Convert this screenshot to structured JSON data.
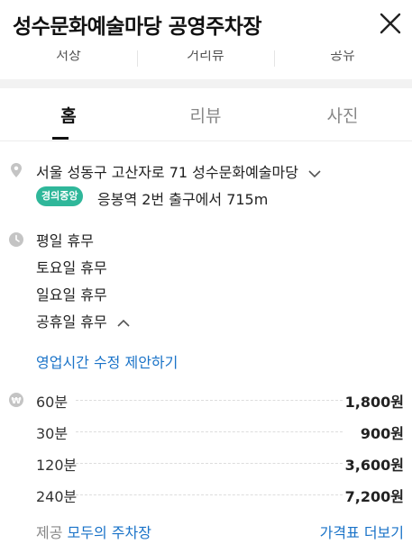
{
  "header": {
    "title": "성수문화예술마당 공영주차장"
  },
  "actions": {
    "items": [
      "저장",
      "거리뷰",
      "공유"
    ]
  },
  "tabs": {
    "items": [
      "홈",
      "리뷰",
      "사진"
    ]
  },
  "place": {
    "address": "서울 성동구 고산자로 71 성수문화예술마당",
    "subway_line": "경의중앙",
    "subway_text": "응봉역 2번 출구에서 715m",
    "subway_color": "#2fb79a"
  },
  "hours": {
    "items": [
      "평일 휴무",
      "토요일 휴무",
      "일요일 휴무",
      "공휴일 휴무"
    ],
    "edit_link": "영업시간 수정 제안하기"
  },
  "prices": {
    "rows": [
      {
        "label": "60분",
        "value": "1,800원"
      },
      {
        "label": "30분",
        "value": "900원"
      },
      {
        "label": "120분",
        "value": "3,600원"
      },
      {
        "label": "240분",
        "value": "7,200원"
      }
    ]
  },
  "footer": {
    "provider_prefix": "제공",
    "provider_name": "모두의 주차장",
    "more_link": "가격표 더보기"
  },
  "colors": {
    "accent": "#1a73c8"
  }
}
